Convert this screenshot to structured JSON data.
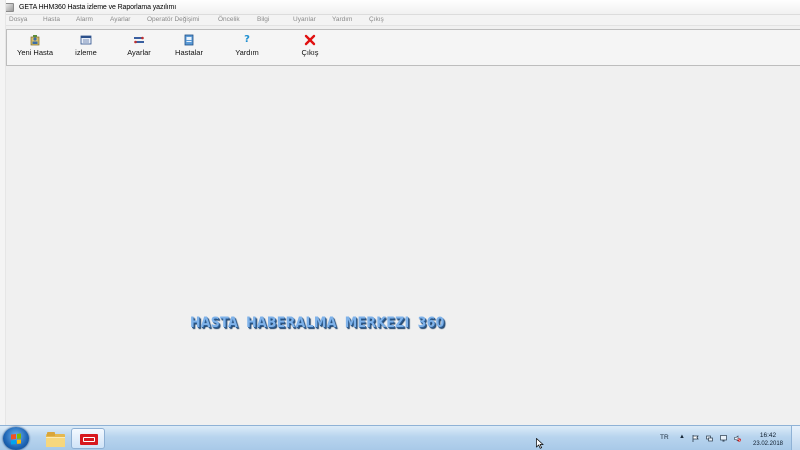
{
  "window": {
    "title": "GETA HHM360  Hasta  izleme ve Raporlama yazılımı"
  },
  "menu": [
    {
      "id": "dosya",
      "label": "Dosya"
    },
    {
      "id": "hasta",
      "label": "Hasta"
    },
    {
      "id": "alarm",
      "label": "Alarm"
    },
    {
      "id": "ayarlar",
      "label": "Ayarlar"
    },
    {
      "id": "operator",
      "label": "Operatör Değişimi"
    },
    {
      "id": "oncelik",
      "label": "Öncelik"
    },
    {
      "id": "bilgi",
      "label": "Bilgi"
    },
    {
      "id": "uyarilar",
      "label": "Uyarılar"
    },
    {
      "id": "yardim",
      "label": "Yardım"
    },
    {
      "id": "cikis",
      "label": "Çıkış"
    }
  ],
  "toolbar": [
    {
      "id": "yeni-hasta",
      "label": "Yeni Hasta",
      "icon": "new-patient-icon"
    },
    {
      "id": "izleme",
      "label": "izleme",
      "icon": "monitor-icon"
    },
    {
      "id": "ayarlar",
      "label": "Ayarlar",
      "icon": "settings-icon"
    },
    {
      "id": "hastalar",
      "label": "Hastalar",
      "icon": "patients-icon"
    },
    {
      "id": "yardim",
      "label": "Yardım",
      "icon": "help-icon"
    },
    {
      "id": "cikis",
      "label": "Çıkış",
      "icon": "exit-icon"
    }
  ],
  "main": {
    "banner": "HASTA HABERALMA MERKEZI 360",
    "banner_color": "#7fb2e9"
  },
  "taskbar": {
    "language": "TR",
    "time": "16:42",
    "date": "23.02.2018"
  },
  "colors": {
    "exit_icon": "#e01010",
    "help_icon": "#1e8fd0",
    "app_logo": "#d7181f"
  }
}
